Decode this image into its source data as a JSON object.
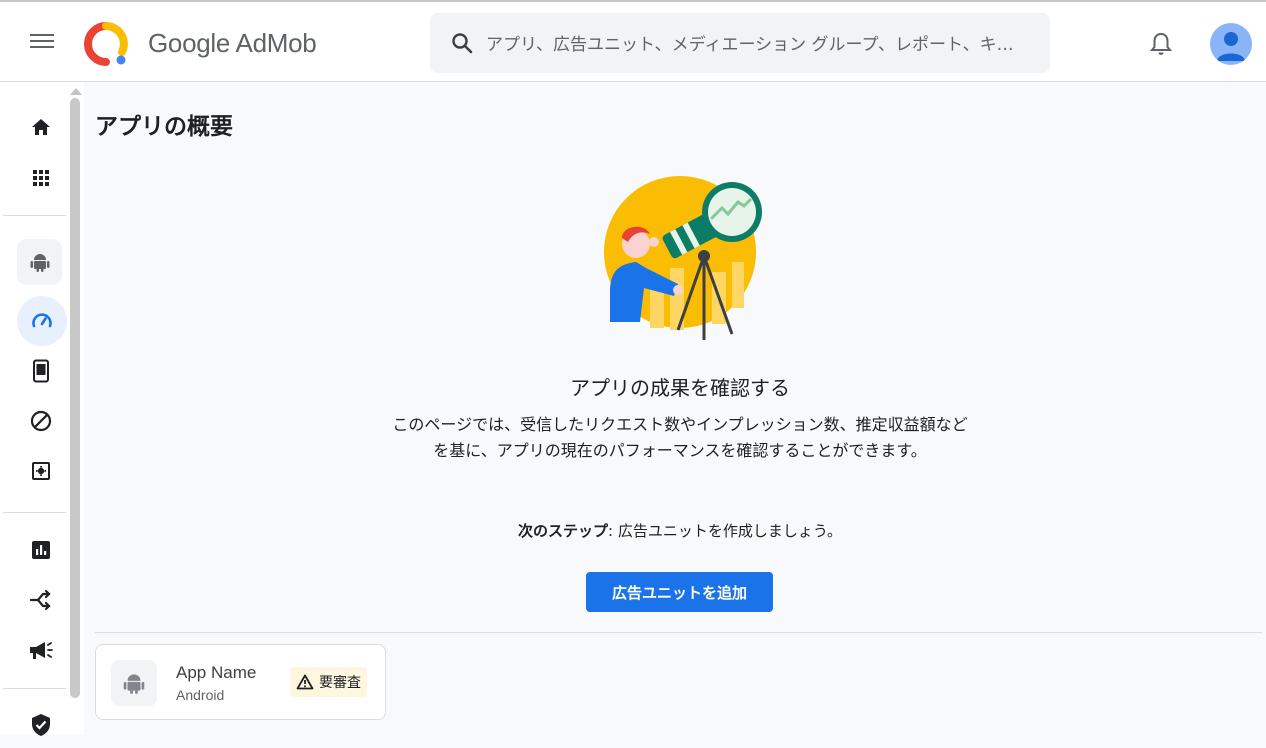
{
  "header": {
    "brand": "Google AdMob",
    "search_placeholder": "アプリ、広告ユニット、メディエーション グループ、レポート、キ…"
  },
  "sidebar": {
    "items": [
      {
        "icon": "home-icon"
      },
      {
        "icon": "apps-grid-icon"
      },
      {
        "icon": "android-icon"
      },
      {
        "icon": "overview-gauge-icon"
      },
      {
        "icon": "ad-units-icon"
      },
      {
        "icon": "blocking-icon"
      },
      {
        "icon": "app-settings-icon"
      },
      {
        "icon": "reports-icon"
      },
      {
        "icon": "mediation-icon"
      },
      {
        "icon": "campaigns-icon"
      },
      {
        "icon": "privacy-shield-icon"
      }
    ]
  },
  "main": {
    "page_title": "アプリの概要",
    "empty_heading": "アプリの成果を確認する",
    "empty_body": "このページでは、受信したリクエスト数やインプレッション数、推定収益額などを基に、アプリの現在のパフォーマンスを確認することができます。",
    "next_step_label": "次のステップ",
    "next_step_text": ": 広告ユニットを作成しましょう。",
    "add_button": "広告ユニットを追加"
  },
  "app_card": {
    "name": "App Name",
    "platform": "Android",
    "status": "要審査"
  },
  "colors": {
    "accent": "#1a73e8",
    "active_nav_bg": "#e8f0fe",
    "badge_bg": "#fef7e0"
  }
}
